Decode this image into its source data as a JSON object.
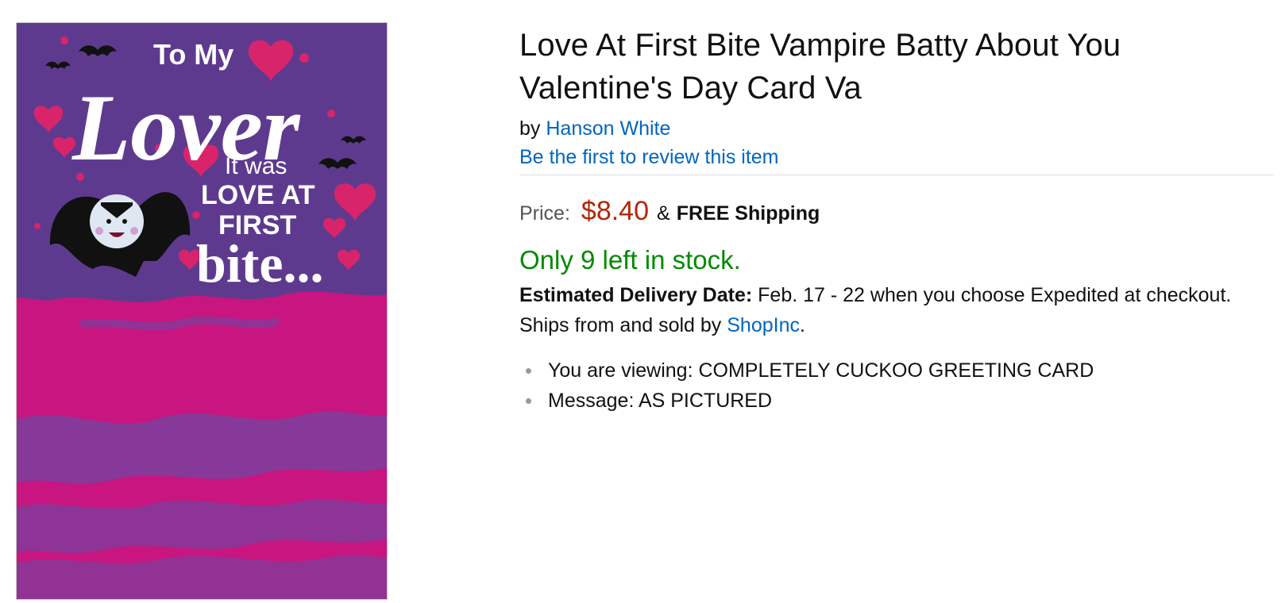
{
  "product": {
    "title": "Love At First Bite Vampire Batty About You Valentine's Day Card Va",
    "by_prefix": "by",
    "brand": "Hanson White",
    "review_link": "Be the first to review this item",
    "price_label": "Price:",
    "price": "$8.40",
    "shipping_amp": "&",
    "shipping": "FREE Shipping",
    "stock": "Only 9 left in stock.",
    "delivery_label": "Estimated Delivery Date:",
    "delivery_text": "Feb. 17 - 22 when you choose Expedited at checkout.",
    "ships_prefix": "Ships from and sold by",
    "seller": "ShopInc",
    "ships_suffix": ".",
    "bullets": [
      "You are viewing: COMPLETELY CUCKOO GREETING CARD",
      "Message: AS PICTURED"
    ]
  },
  "card_image": {
    "line1": "To My",
    "line2": "Lover",
    "line3": "It was",
    "line4": "LOVE AT",
    "line5": "FIRST",
    "line6": "bite...",
    "colors": {
      "top": "#5e3a8f",
      "bottom": "#c8157f",
      "heart": "#d8246b",
      "text": "#ffffff"
    }
  },
  "colors": {
    "link": "#0066c0",
    "price": "#b12704",
    "stock": "#008a00"
  }
}
